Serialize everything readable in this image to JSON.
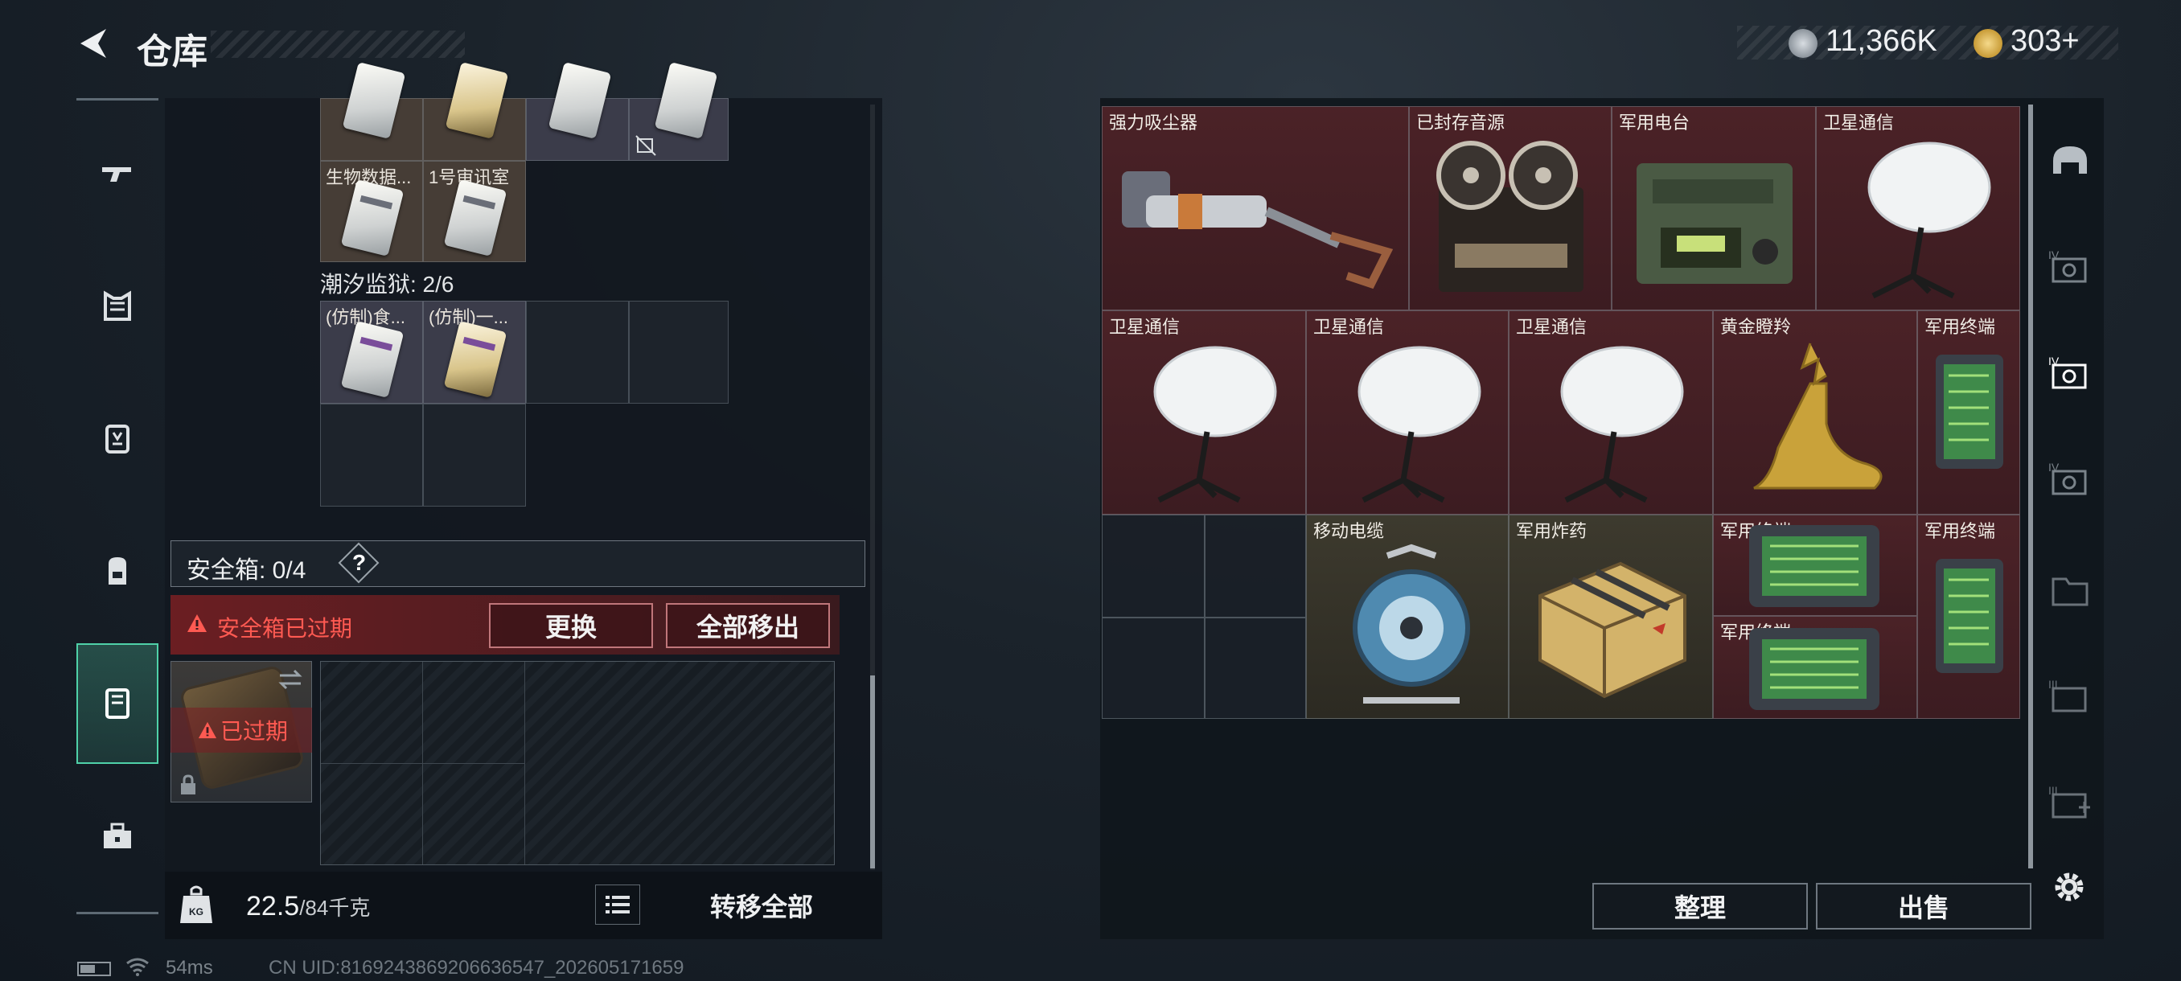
{
  "header": {
    "title": "仓库",
    "currency_1": "11,366K",
    "currency_2": "303+"
  },
  "left_nav": {
    "items": [
      {
        "icon": "gun-icon"
      },
      {
        "icon": "armor-icon"
      },
      {
        "icon": "chest-rig-icon"
      },
      {
        "icon": "backpack-icon"
      },
      {
        "icon": "container-icon",
        "active": true
      },
      {
        "icon": "toolbox-icon"
      }
    ]
  },
  "container": {
    "top_items": [
      {
        "label": "生物数据..."
      },
      {
        "label": "1号审讯室"
      }
    ],
    "prison_label": "潮汐监狱: 2/6",
    "prison_items": [
      {
        "label": "(仿制)食..."
      },
      {
        "label": "(仿制)一..."
      }
    ]
  },
  "safe_box": {
    "label": "安全箱: 0/4",
    "help": "?",
    "expired_text": "安全箱已过期",
    "replace_label": "更换",
    "move_all_label": "全部移出",
    "slot_text": "已过期"
  },
  "bottom_bar": {
    "weight_current": "22.5",
    "weight_max": "/84千克",
    "transfer_all_label": "转移全部"
  },
  "inventory": {
    "items": [
      {
        "label": "强力吸尘器",
        "icon": "vacuum-icon"
      },
      {
        "label": "已封存音源",
        "icon": "tape-recorder-icon"
      },
      {
        "label": "军用电台",
        "icon": "radio-icon"
      },
      {
        "label": "卫星通信",
        "icon": "satellite-dish-icon"
      },
      {
        "label": "卫星通信",
        "icon": "satellite-dish-icon"
      },
      {
        "label": "卫星通信",
        "icon": "satellite-dish-icon"
      },
      {
        "label": "卫星通信",
        "icon": "satellite-dish-icon"
      },
      {
        "label": "黄金瞪羚",
        "icon": "golden-gazelle-icon"
      },
      {
        "label": "军用终端",
        "icon": "terminal-icon"
      },
      {
        "label": "移动电缆",
        "icon": "cable-reel-icon"
      },
      {
        "label": "军用炸药",
        "icon": "explosive-crate-icon"
      },
      {
        "label": "军用终端",
        "icon": "terminal-icon"
      },
      {
        "label": "军用终端",
        "icon": "terminal-icon"
      },
      {
        "label": "军用终端",
        "icon": "terminal-icon"
      }
    ],
    "sort_label": "整理",
    "sell_label": "出售"
  },
  "right_nav": {
    "items": [
      {
        "icon": "helmet-icon"
      },
      {
        "icon": "key-card-level-4-icon"
      },
      {
        "icon": "key-card-level-4-active-icon"
      },
      {
        "icon": "key-card-level-4-icon"
      },
      {
        "icon": "folder-icon"
      },
      {
        "icon": "key-card-level-3-icon"
      },
      {
        "icon": "key-card-add-icon"
      }
    ],
    "settings_icon": "gear-icon"
  },
  "status": {
    "ping": "54ms",
    "uid": "CN UID:8169243869206636547_202605171659"
  },
  "colors": {
    "accent": "#4fd1a8",
    "danger": "#ff5a52",
    "item_red": "#4b2227",
    "item_gold": "#3d3a2e"
  }
}
